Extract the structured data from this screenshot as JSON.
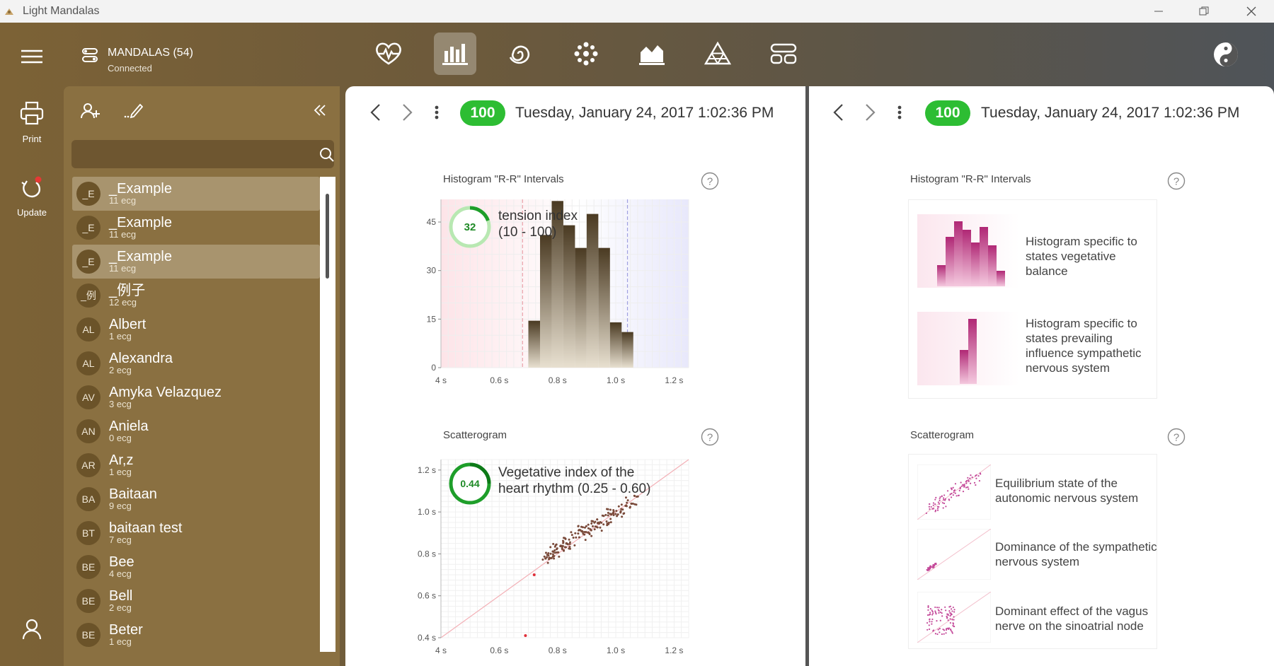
{
  "window": {
    "title": "Light Mandalas"
  },
  "header": {
    "connection_title": "MANDALAS (54)",
    "connection_status": "Connected",
    "nav": [
      {
        "name": "heart-rate-icon",
        "active": false
      },
      {
        "name": "bar-chart-icon",
        "active": true
      },
      {
        "name": "spiral-icon",
        "active": false
      },
      {
        "name": "mandala-icon",
        "active": false
      },
      {
        "name": "area-chart-icon",
        "active": false
      },
      {
        "name": "triangle-dots-icon",
        "active": false
      },
      {
        "name": "layout-icon",
        "active": false
      }
    ]
  },
  "rail": {
    "print_label": "Print",
    "update_label": "Update"
  },
  "search": {
    "placeholder": "",
    "value": ""
  },
  "people": [
    {
      "initials": "_E",
      "name": "_Example",
      "count": "11 ecg",
      "selected": true
    },
    {
      "initials": "_E",
      "name": "_Example",
      "count": "11 ecg",
      "selected": false
    },
    {
      "initials": "_E",
      "name": "_Example",
      "count": "11 ecg",
      "selected": true
    },
    {
      "initials": "_例",
      "name": "_例子",
      "count": "12 ecg",
      "selected": false
    },
    {
      "initials": "AL",
      "name": "Albert",
      "count": "1 ecg",
      "selected": false
    },
    {
      "initials": "AL",
      "name": "Alexandra",
      "count": "2 ecg",
      "selected": false
    },
    {
      "initials": "AV",
      "name": "Amyka Velazquez",
      "count": "3 ecg",
      "selected": false
    },
    {
      "initials": "AN",
      "name": "Aniela",
      "count": "0 ecg",
      "selected": false
    },
    {
      "initials": "AR",
      "name": "Ar,z",
      "count": "1 ecg",
      "selected": false
    },
    {
      "initials": "BA",
      "name": "Baitaan",
      "count": "9 ecg",
      "selected": false
    },
    {
      "initials": "BT",
      "name": "baitaan test",
      "count": "7 ecg",
      "selected": false
    },
    {
      "initials": "BE",
      "name": "Bee",
      "count": "4 ecg",
      "selected": false
    },
    {
      "initials": "BE",
      "name": "Bell",
      "count": "2 ecg",
      "selected": false
    },
    {
      "initials": "BE",
      "name": "Beter",
      "count": "1 ecg",
      "selected": false
    }
  ],
  "left_card": {
    "score": "100",
    "date": "Tuesday, January 24, 2017 1:02:36 PM",
    "histogram_title": "Histogram \"R-R\" Intervals",
    "tension_value": "32",
    "tension_label": "tension index",
    "tension_range": "(10 - 100)",
    "scatter_title": "Scatterogram",
    "veg_value": "0.44",
    "veg_label": "Vegetative index of the",
    "veg_label2": "heart rhythm (0.25 - 0.60)"
  },
  "right_card": {
    "score": "100",
    "date": "Tuesday, January 24, 2017 1:02:36 PM",
    "histogram_title": "Histogram \"R-R\" Intervals",
    "hist_legend": [
      "Histogram specific to states vegetative balance",
      "Histogram specific to states prevailing influence sympathetic nervous system"
    ],
    "scatter_title": "Scatterogram",
    "scatter_legend": [
      "Equilibrium state of the autonomic nervous system",
      "Dominance of the sympathetic nervous system",
      "Dominant effect of the vagus nerve on the sinoatrial node"
    ]
  },
  "colors": {
    "accent_green": "#2dbd33",
    "bar_brown": "#5c4a30",
    "pink": "#d0508f"
  },
  "chart_data": [
    {
      "type": "bar",
      "title": "Histogram \"R-R\" Intervals",
      "xlabel": "",
      "ylabel": "",
      "x_ticks": [
        "4 s",
        "0.6 s",
        "0.8 s",
        "1.0 s",
        "1.2 s"
      ],
      "y_ticks": [
        "0",
        "15",
        "30",
        "45"
      ],
      "xlim": [
        0.4,
        1.25
      ],
      "ylim": [
        0,
        52
      ],
      "bin_width": 0.04,
      "x": [
        0.72,
        0.76,
        0.8,
        0.84,
        0.88,
        0.92,
        0.96,
        1.0,
        1.04
      ],
      "values": [
        14.5,
        41,
        51.5,
        44,
        37,
        47.5,
        37,
        14,
        11
      ],
      "markers": [
        0.68,
        1.04
      ]
    },
    {
      "type": "scatter",
      "title": "Scatterogram",
      "x_ticks": [
        "4 s",
        "0.6 s",
        "0.8 s",
        "1.0 s",
        "1.2 s"
      ],
      "y_ticks": [
        "0.4 s",
        "0.6 s",
        "0.8 s",
        "1.0 s",
        "1.2 s"
      ],
      "xlim": [
        0.4,
        1.25
      ],
      "ylim": [
        0.4,
        1.25
      ],
      "cluster": {
        "x_range": [
          0.76,
          1.06
        ],
        "y_range": [
          0.78,
          1.06
        ],
        "count": 180
      },
      "outliers": [
        [
          0.72,
          0.7
        ],
        [
          0.69,
          0.41
        ]
      ]
    }
  ]
}
